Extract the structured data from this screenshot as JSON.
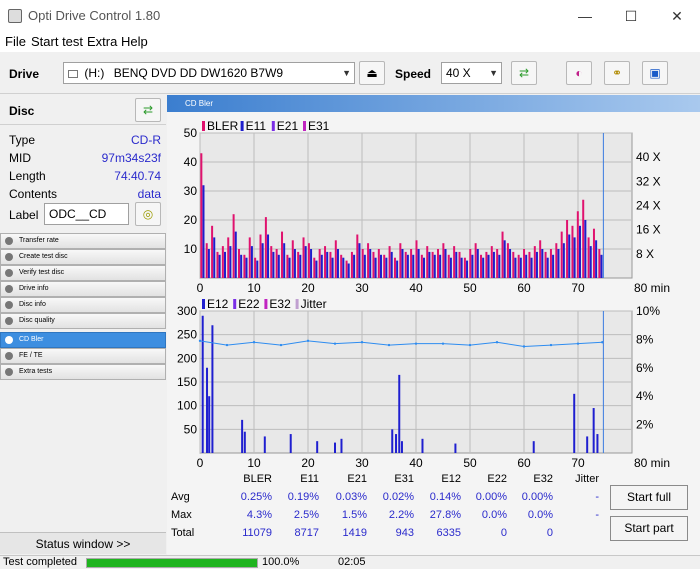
{
  "window": {
    "title": "Opti Drive Control 1.80",
    "minimize": "—",
    "maximize": "☐",
    "close": "✕"
  },
  "menu": [
    "File",
    "Start test",
    "Extra",
    "Help"
  ],
  "toolbar": {
    "drive_label": "Drive",
    "drive_letter": "(H:)",
    "drive_name": "BENQ DVD DD DW1620 B7W9",
    "speed_label": "Speed",
    "speed_value": "40 X",
    "eject_icon": "⏏",
    "refresh_icon": "⇄",
    "erase_icon": "◐",
    "copy_icon": "⚭",
    "save_icon": "▣"
  },
  "disc": {
    "heading": "Disc",
    "rows": [
      {
        "key": "Type",
        "value": "CD-R"
      },
      {
        "key": "MID",
        "value": "97m34s23f"
      },
      {
        "key": "Length",
        "value": "74:40.74"
      },
      {
        "key": "Contents",
        "value": "data"
      }
    ],
    "label_key": "Label",
    "label_value": "ODC__CD"
  },
  "nav": [
    "Transfer rate",
    "Create test disc",
    "Verify test disc",
    "Drive info",
    "Disc info",
    "Disc quality",
    "CD Bler",
    "FE / TE",
    "Extra tests"
  ],
  "nav_active": 6,
  "status_window": "Status window >>",
  "panel_title": "CD Bler",
  "colors": {
    "bler": "#e0126e",
    "e11": "#1d1dcc",
    "e21": "#7a2ee6",
    "e31": "#c024c0",
    "e12": "#1f1fd0",
    "jitter": "#2e8cf0",
    "marker": "#3a7be0"
  },
  "chart_data": [
    {
      "type": "bar",
      "legend": [
        "BLER",
        "E11",
        "E21",
        "E31"
      ],
      "x_ticks": [
        0,
        10,
        20,
        30,
        40,
        50,
        60,
        70
      ],
      "x_unit": "80 min",
      "xlim": [
        0,
        80
      ],
      "y_ticks": [
        10,
        20,
        30,
        40,
        50
      ],
      "ylim": [
        0,
        50
      ],
      "y2_ticks": [
        "8 X",
        "16 X",
        "24 X",
        "32 X",
        "40 X"
      ],
      "y2lim": [
        0,
        48
      ],
      "marker_x": 74.7,
      "series": [
        {
          "name": "BLER",
          "values": [
            43,
            12,
            18,
            9,
            11,
            14,
            22,
            10,
            8,
            14,
            7,
            15,
            21,
            11,
            10,
            16,
            8,
            13,
            9,
            14,
            12,
            7,
            10,
            11,
            9,
            13,
            8,
            6,
            9,
            15,
            10,
            12,
            9,
            10,
            8,
            11,
            7,
            12,
            9,
            10,
            13,
            8,
            11,
            9,
            10,
            12,
            8,
            11,
            9,
            7,
            10,
            12,
            8,
            9,
            11,
            10,
            16,
            12,
            9,
            8,
            10,
            9,
            11,
            13,
            9,
            10,
            12,
            16,
            20,
            18,
            23,
            27,
            14,
            17,
            10
          ]
        },
        {
          "name": "E11",
          "values": [
            32,
            10,
            14,
            8,
            9,
            11,
            16,
            8,
            7,
            11,
            6,
            12,
            15,
            9,
            8,
            12,
            7,
            10,
            8,
            11,
            10,
            6,
            8,
            9,
            7,
            10,
            7,
            5,
            8,
            12,
            8,
            10,
            7,
            8,
            7,
            9,
            6,
            10,
            8,
            8,
            10,
            7,
            9,
            8,
            8,
            10,
            7,
            9,
            7,
            6,
            8,
            10,
            7,
            8,
            9,
            8,
            13,
            10,
            7,
            7,
            8,
            7,
            9,
            10,
            7,
            8,
            10,
            12,
            15,
            14,
            18,
            20,
            11,
            13,
            8
          ]
        }
      ]
    },
    {
      "type": "bar",
      "legend": [
        "E12",
        "E22",
        "E32",
        "Jitter"
      ],
      "x_ticks": [
        0,
        10,
        20,
        30,
        40,
        50,
        60,
        70
      ],
      "x_unit": "80 min",
      "xlim": [
        0,
        80
      ],
      "y_ticks": [
        50,
        100,
        150,
        200,
        250,
        300
      ],
      "ylim": [
        0,
        300
      ],
      "y2_ticks": [
        "2%",
        "4%",
        "6%",
        "8%",
        "10%"
      ],
      "y2lim": [
        0,
        10
      ],
      "marker_x": 74.7,
      "series": [
        {
          "name": "E12",
          "x": [
            0.5,
            1.3,
            1.7,
            2.3,
            7.8,
            8.3,
            12,
            16.8,
            21.7,
            25,
            26.2,
            35.6,
            36.3,
            36.9,
            37.4,
            41.2,
            47.3,
            61.8,
            69.3,
            71.7,
            72.9,
            73.6
          ],
          "values": [
            290,
            180,
            120,
            270,
            70,
            45,
            35,
            40,
            25,
            22,
            30,
            50,
            40,
            165,
            25,
            30,
            20,
            25,
            125,
            35,
            95,
            40
          ]
        },
        {
          "name": "Jitter",
          "x": [
            0,
            5,
            10,
            15,
            20,
            25,
            30,
            35,
            40,
            45,
            50,
            55,
            60,
            65,
            70,
            74.5
          ],
          "values": [
            7.9,
            7.6,
            7.8,
            7.6,
            7.9,
            7.7,
            7.8,
            7.6,
            7.7,
            7.7,
            7.6,
            7.8,
            7.5,
            7.6,
            7.7,
            7.8
          ]
        }
      ]
    }
  ],
  "stats": {
    "headers": [
      "BLER",
      "E11",
      "E21",
      "E31",
      "E12",
      "E22",
      "E32",
      "Jitter"
    ],
    "rows": [
      {
        "label": "Avg",
        "values": [
          "0.25%",
          "0.19%",
          "0.03%",
          "0.02%",
          "0.14%",
          "0.00%",
          "0.00%",
          "-"
        ]
      },
      {
        "label": "Max",
        "values": [
          "4.3%",
          "2.5%",
          "1.5%",
          "2.2%",
          "27.8%",
          "0.0%",
          "0.0%",
          "-"
        ]
      },
      {
        "label": "Total",
        "values": [
          "11079",
          "8717",
          "1419",
          "943",
          "6335",
          "0",
          "0",
          ""
        ]
      }
    ]
  },
  "buttons": {
    "start_full": "Start full",
    "start_part": "Start part"
  },
  "statusbar": {
    "text": "Test completed",
    "progress_percent": 100.0,
    "progress_label": "100.0%",
    "time": "02:05"
  }
}
